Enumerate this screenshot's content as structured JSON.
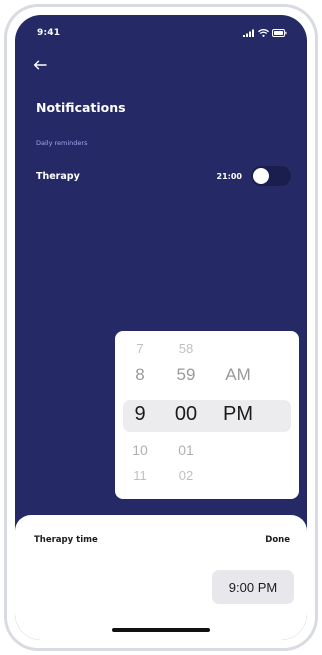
{
  "status_bar": {
    "time": "9:41",
    "icons": [
      "signal-icon",
      "wifi-icon",
      "battery-icon"
    ]
  },
  "header": {
    "back_icon": "arrow-left-icon",
    "title": "Notifications"
  },
  "reminders": {
    "section_label": "Daily reminders",
    "items": [
      {
        "label": "Therapy",
        "time": "21:00",
        "enabled": false
      }
    ]
  },
  "time_picker": {
    "hours": [
      "7",
      "8",
      "9",
      "10",
      "11"
    ],
    "minutes": [
      "58",
      "59",
      "00",
      "01",
      "02"
    ],
    "periods": [
      "AM",
      "PM"
    ],
    "selected": {
      "hour": "9",
      "minute": "00",
      "period": "PM"
    }
  },
  "bottom_sheet": {
    "title": "Therapy time",
    "done_label": "Done",
    "selected_time": "9:00 PM"
  },
  "colors": {
    "background": "#252a67",
    "accent_text": "#9fa6ea",
    "toggle_track": "#1a1e4e",
    "sheet": "#ffffff"
  }
}
